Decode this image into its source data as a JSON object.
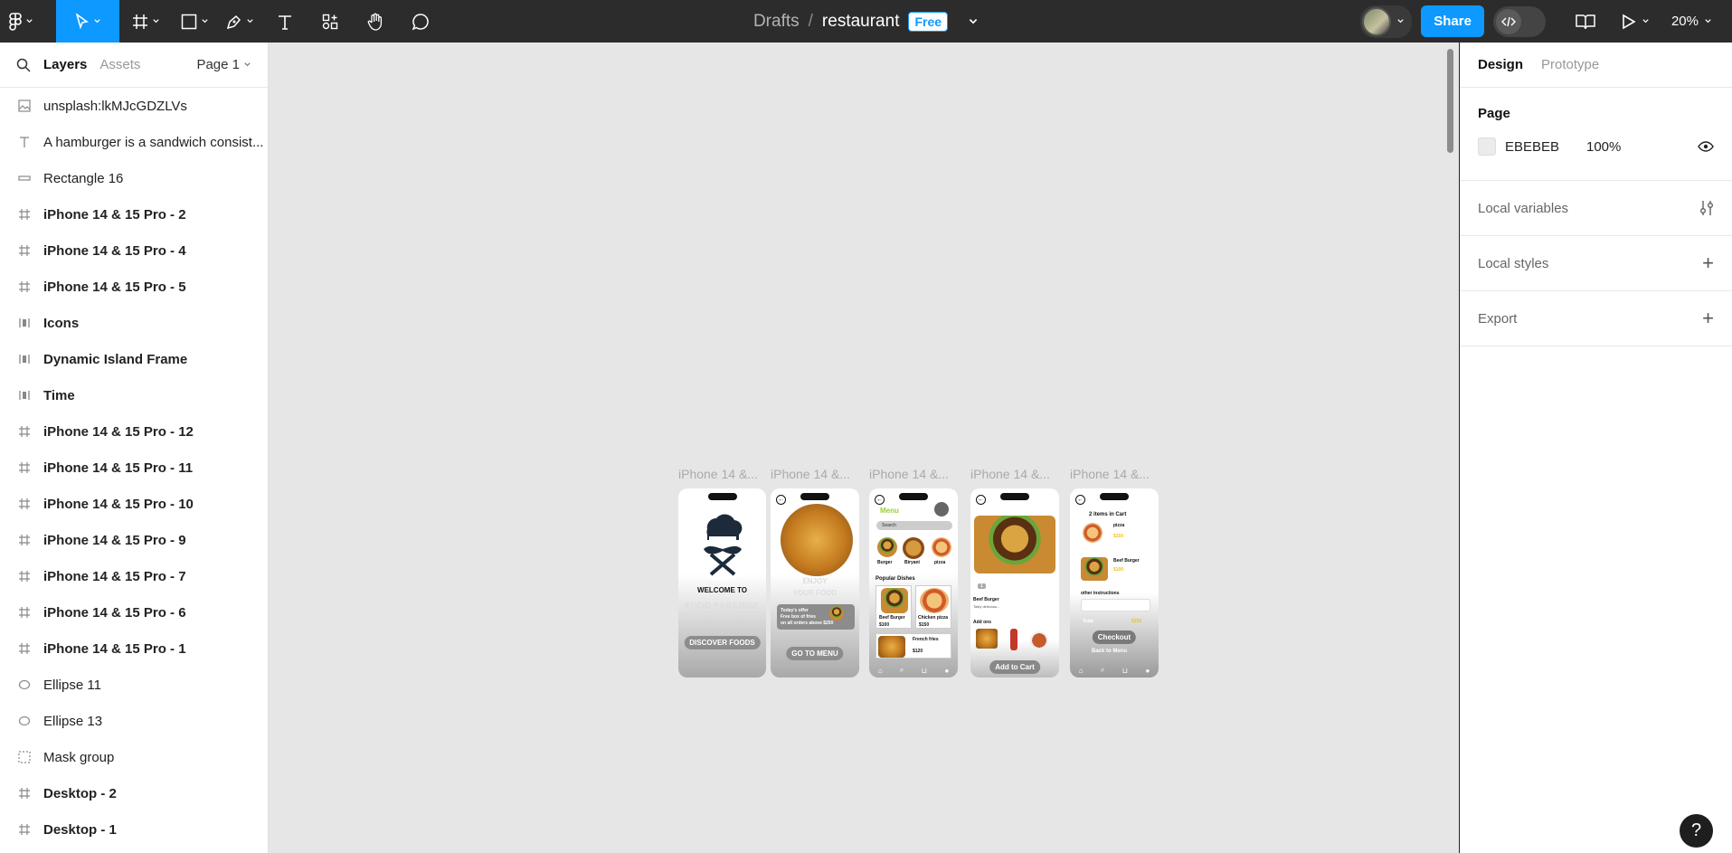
{
  "toolbar": {
    "breadcrumb_drafts": "Drafts",
    "breadcrumb_sep": "/",
    "file_name": "restaurant",
    "plan_badge": "Free",
    "share_label": "Share",
    "zoom_label": "20%"
  },
  "left_panel": {
    "tabs": [
      "Layers",
      "Assets"
    ],
    "page_selector": "Page 1",
    "layers": [
      {
        "name": "unsplash:lkMJcGDZLVs",
        "icon": "image-icon"
      },
      {
        "name": "A hamburger is a sandwich consist...",
        "icon": "text-icon"
      },
      {
        "name": "Rectangle 16",
        "icon": "rectangle-icon"
      },
      {
        "name": "iPhone 14 & 15 Pro - 2",
        "icon": "frame-icon"
      },
      {
        "name": "iPhone 14 & 15 Pro - 4",
        "icon": "frame-icon"
      },
      {
        "name": "iPhone 14 & 15 Pro - 5",
        "icon": "frame-icon"
      },
      {
        "name": "Icons",
        "icon": "autolayout-icon"
      },
      {
        "name": "Dynamic Island Frame",
        "icon": "autolayout-icon"
      },
      {
        "name": "Time",
        "icon": "autolayout-icon"
      },
      {
        "name": "iPhone 14 & 15 Pro - 12",
        "icon": "frame-icon"
      },
      {
        "name": "iPhone 14 & 15 Pro - 11",
        "icon": "frame-icon"
      },
      {
        "name": "iPhone 14 & 15 Pro - 10",
        "icon": "frame-icon"
      },
      {
        "name": "iPhone 14 & 15 Pro - 9",
        "icon": "frame-icon"
      },
      {
        "name": "iPhone 14 & 15 Pro - 7",
        "icon": "frame-icon"
      },
      {
        "name": "iPhone 14 & 15 Pro - 6",
        "icon": "frame-icon"
      },
      {
        "name": "iPhone 14 & 15 Pro - 1",
        "icon": "frame-icon"
      },
      {
        "name": "Ellipse 11",
        "icon": "ellipse-icon"
      },
      {
        "name": "Ellipse 13",
        "icon": "ellipse-icon"
      },
      {
        "name": "Mask group",
        "icon": "mask-icon"
      },
      {
        "name": "Desktop - 2",
        "icon": "frame-icon"
      },
      {
        "name": "Desktop - 1",
        "icon": "frame-icon"
      }
    ]
  },
  "canvas": {
    "frame_labels": [
      "iPhone 14 &...",
      "iPhone 14 &...",
      "iPhone 14 &...",
      "iPhone 14 &...",
      "iPhone 14 &..."
    ],
    "screen1": {
      "welcome": "WELCOME TO",
      "brand": "FOOD PARADISE",
      "cta": "DISCOVER FOODS"
    },
    "screen2": {
      "line1": "ENJOY",
      "line2": "YOUR FOOD",
      "offer_title": "Today's offer",
      "offer_line1": "Free box of fries",
      "offer_line2": "on all orders above $250",
      "cta": "GO TO MENU"
    },
    "screen3": {
      "title": "Menu",
      "search": "Search",
      "categories": [
        "Burger",
        "Biryani",
        "pizza"
      ],
      "section": "Popular Dishes",
      "items": [
        {
          "name": "Beef Burger",
          "price": "$100"
        },
        {
          "name": "Chicken pizza",
          "price": "$150"
        },
        {
          "name": "French fries",
          "price": "$120"
        }
      ]
    },
    "screen4": {
      "title": "Beef Burger",
      "desc": "Tasty delicious...",
      "addons": "Add ons",
      "cta": "Add to Cart",
      "qty": "1"
    },
    "screen5": {
      "title": "2 items in Cart",
      "item1": "pizza",
      "price1": "$150",
      "item2": "Beef Burger",
      "price2": "$100",
      "instructions": "other instructions",
      "total_label": "Total:",
      "total_value": "$250",
      "checkout": "Checkout",
      "back": "Back to Menu"
    }
  },
  "right_panel": {
    "tabs": [
      "Design",
      "Prototype"
    ],
    "page_title": "Page",
    "page_color_hex": "EBEBEB",
    "page_opacity": "100%",
    "local_variables": "Local variables",
    "local_styles": "Local styles",
    "export": "Export",
    "help": "?"
  },
  "colors": {
    "accent": "#0d99ff",
    "topbar": "#2c2c2c",
    "canvas": "#e6e6e6"
  }
}
